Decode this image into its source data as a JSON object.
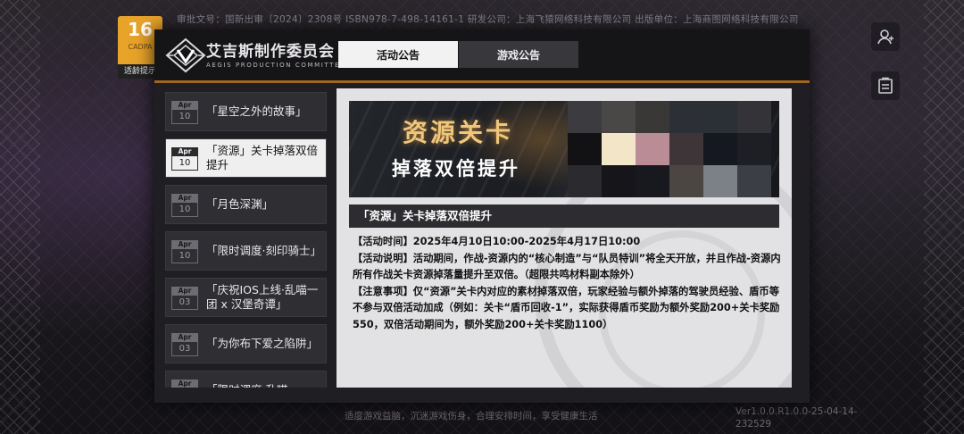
{
  "top_info": "审批文号：国新出审〔2024〕2308号 ISBN978-7-498-14161-1 研发公司：上海飞猿网络科技有限公司 出版单位：上海商图网络科技有限公司",
  "age_rating": {
    "number": "16",
    "sub": "CADPA",
    "label": "适龄提示"
  },
  "bottom_hint": "适度游戏益脑，沉迷游戏伤身，合理安排时间，享受健康生活",
  "version": "Ver1.0.0.R1.0.0-25-04-14-232529",
  "brand": {
    "name": "艾吉斯制作委员会",
    "english": "AEGIS PRODUCTION COMMITTEE"
  },
  "tabs": [
    {
      "label": "活动公告",
      "active": true
    },
    {
      "label": "游戏公告",
      "active": false
    }
  ],
  "announcements": [
    {
      "month": "Apr",
      "day": "10",
      "title": "「星空之外的故事」"
    },
    {
      "month": "Apr",
      "day": "10",
      "title": "「资源」关卡掉落双倍提升"
    },
    {
      "month": "Apr",
      "day": "10",
      "title": "「月色深渊」"
    },
    {
      "month": "Apr",
      "day": "10",
      "title": "「限时调度·刻印骑士」"
    },
    {
      "month": "Apr",
      "day": "03",
      "title": "「庆祝IOS上线·乱喵一团 x 汉堡奇谭」"
    },
    {
      "month": "Apr",
      "day": "03",
      "title": "「为你布下爱之陷阱」"
    },
    {
      "month": "Apr",
      "day": "",
      "title": "「限时调度·乱喵一"
    }
  ],
  "selected_index": 1,
  "detail": {
    "banner_line1": "资源关卡",
    "banner_line2": "掉落双倍提升",
    "heading": "「资源」关卡掉落双倍提升",
    "paragraphs": [
      "【活动时间】2025年4月10日10:00-2025年4月17日10:00",
      "【活动说明】活动期间，作战-资源内的“核心制造”与“队员特训”将全天开放，并且作战-资源内所有作战关卡资源掉落量提升至双倍。（超限共鸣材料副本除外）",
      "【注意事项】仅“资源”关卡内对应的素材掉落双倍，玩家经验与额外掉落的驾驶员经验、盾币等不参与双倍活动加成（例如：关卡“盾币回收-1”，实际获得盾币奖励为额外奖励200+关卡奖励550，双倍活动期间为，额外奖励200+关卡奖励1100）"
    ]
  }
}
